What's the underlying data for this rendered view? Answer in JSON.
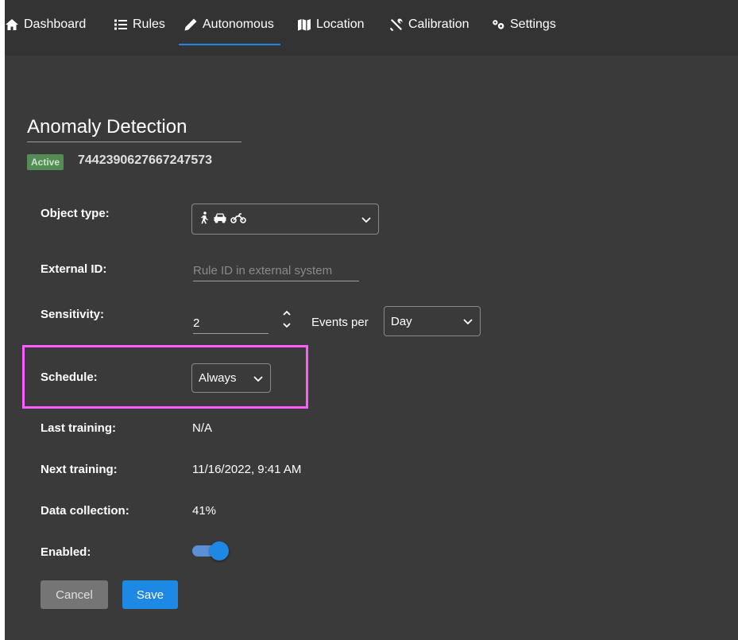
{
  "nav": {
    "items": [
      {
        "label": "Dashboard",
        "icon": "home-icon"
      },
      {
        "label": "Rules",
        "icon": "list-icon"
      },
      {
        "label": "Autonomous",
        "icon": "pen-icon"
      },
      {
        "label": "Location",
        "icon": "map-icon"
      },
      {
        "label": "Calibration",
        "icon": "tools-icon"
      },
      {
        "label": "Settings",
        "icon": "gears-icon"
      }
    ],
    "active": "Autonomous",
    "accent": "#1e88e5"
  },
  "rule": {
    "title": "Anomaly Detection",
    "status": "Active",
    "id": "7442390627667247573"
  },
  "form": {
    "object_type": {
      "label": "Object type:",
      "icons": [
        "walking-person-icon",
        "car-icon",
        "motorcycle-icon"
      ]
    },
    "external_id": {
      "label": "External ID:",
      "value": "",
      "placeholder": "Rule ID in external system"
    },
    "sensitivity": {
      "label": "Sensitivity:",
      "value": "2",
      "events_per_label": "Events per",
      "period": "Day"
    },
    "schedule": {
      "label": "Schedule:",
      "value": "Always"
    },
    "last_training": {
      "label": "Last training:",
      "value": "N/A"
    },
    "next_training": {
      "label": "Next training:",
      "value": "11/16/2022, 9:41 AM"
    },
    "data_collection": {
      "label": "Data collection:",
      "value": "41%"
    },
    "enabled": {
      "label": "Enabled:",
      "value": true
    }
  },
  "buttons": {
    "cancel": "Cancel",
    "save": "Save"
  },
  "colors": {
    "background": "#3a3a3a",
    "highlight": "#ff5cff",
    "status_badge": "#558b55",
    "primary": "#1e88e5"
  }
}
